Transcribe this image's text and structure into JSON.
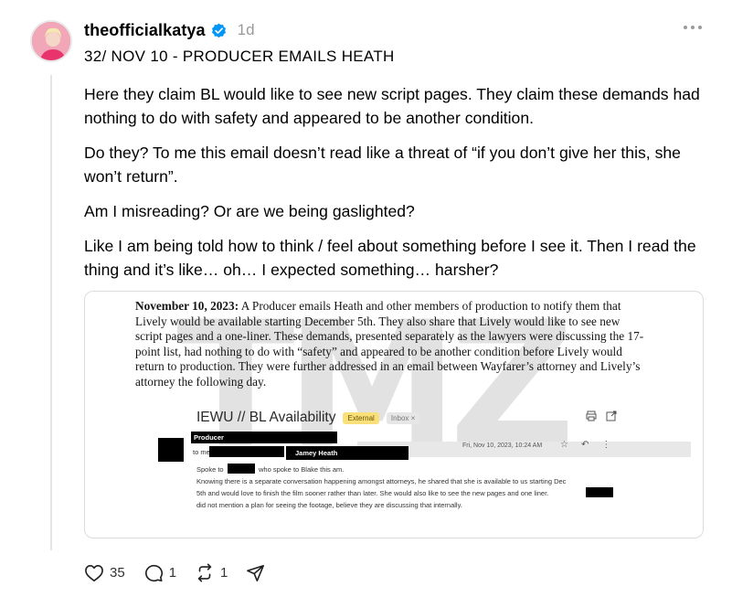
{
  "post": {
    "username": "theofficialkatya",
    "time": "1d",
    "subtitle": "32/ NOV 10 - PRODUCER EMAILS HEATH",
    "paragraphs": [
      "Here they claim BL would like to see new script pages. They claim these demands had nothing to do with safety and appeared to be another condition.",
      "Do they? To me this email doesn’t read like a threat of “if you don’t give her this, she won’t return”.",
      "Am I misreading? Or are we being gaslighted?",
      "Like I am being told how to think / feel about something before I see it. Then I read the thing and it’s like… oh… I expected something… harsher?"
    ]
  },
  "media": {
    "watermark": "TMZ",
    "doc_date": "November 10, 2023:",
    "doc_text": " A Producer emails Heath and other members of production to notify them that Lively would be available starting December 5th. They also share that Lively would like to see new script pages and a one-liner. These demands, presented separately as the lawyers were discussing the 17-point list, had nothing to do with “safety” and appeared to be another condition before Lively would return to production. They were further addressed in an email between Wayfarer’s attorney and Lively’s attorney the following day.",
    "email": {
      "subject": "IEWU // BL Availability",
      "badge_external": "External",
      "badge_inbox": "Inbox ×",
      "from_label": "Producer",
      "to_label": "to me,",
      "recipient": "Jamey Heath",
      "date": "Fri, Nov 10, 2023, 10:24 AM",
      "line1a": "Spoke to",
      "line1b": "who spoke to Blake this am.",
      "line2": "Knowing there is a separate conversation happening amongst attorneys, he shared that she is available to us starting Dec",
      "line3": "5th and would love to finish the film sooner rather than later. She would also like to see the new pages and one liner.",
      "line4": "did not mention a plan for seeing the footage, believe they are discussing that internally."
    }
  },
  "actions": {
    "likes": "35",
    "replies": "1",
    "reposts": "1"
  },
  "colors": {
    "verified": "#0095f6",
    "avatar_bg": "#e86a8b",
    "badge_external": "#f9e07a"
  }
}
